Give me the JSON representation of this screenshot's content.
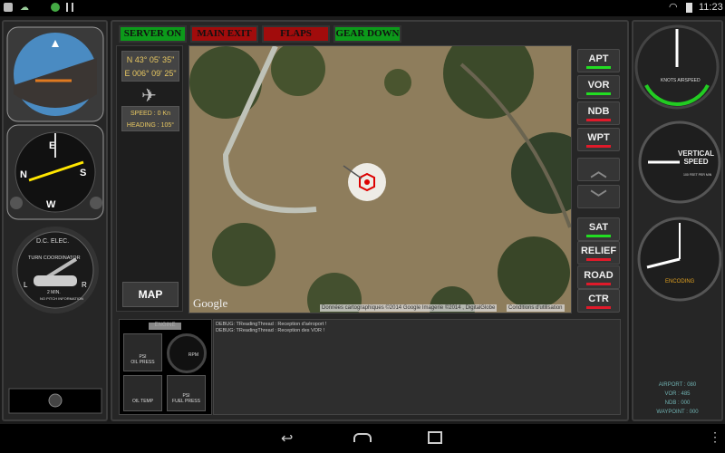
{
  "status_bar": {
    "time": "11:23",
    "icons": [
      "notification-icon",
      "android-icon",
      "badge-icon",
      "barcode-icon",
      "wifi-icon",
      "battery-icon"
    ]
  },
  "top_buttons": [
    {
      "label": "SERVER ON",
      "color": "#0c9a1a"
    },
    {
      "label": "MAIN EXIT",
      "color": "#a10c0c"
    },
    {
      "label": "FLAPS",
      "color": "#a10c0c"
    },
    {
      "label": "GEAR DOWN",
      "color": "#0c9a1a"
    }
  ],
  "info": {
    "lat": "N 43° 05' 35\"",
    "lon": "E 006° 09' 25\"",
    "speed": "SPEED :  0 Kn",
    "heading": "HEADING : 105°",
    "map_button": "MAP"
  },
  "map": {
    "logo": "Google",
    "attribution": "Données cartographiques ©2014 Google Imagerie ©2014 , DigitalGlobe",
    "terms": "Conditions d'utilisation"
  },
  "right_buttons": [
    {
      "label": "APT",
      "state": "on"
    },
    {
      "label": "VOR",
      "state": "on"
    },
    {
      "label": "NDB",
      "state": "off"
    },
    {
      "label": "WPT",
      "state": "off"
    }
  ],
  "layer_buttons": [
    {
      "label": "SAT",
      "state": "on"
    },
    {
      "label": "RELIEF",
      "state": "off"
    },
    {
      "label": "ROAD",
      "state": "off"
    },
    {
      "label": "CTR",
      "state": "off"
    }
  ],
  "colors": {
    "on": "#22dd22",
    "off": "#e01a2a"
  },
  "engine": {
    "title": "ENGINE",
    "oil_press": "OIL PRESS",
    "rpm": "RPM",
    "oil_temp": "OIL TEMP",
    "fuel_press": "FUEL PRESS",
    "psi": "PSI"
  },
  "debug": [
    "DEBUG: TReadingThread : Reception d'aéroport !",
    "DEBUG: TReadingThread : Reception des VOR !"
  ],
  "instruments": {
    "turn_coord_top": "D.C. ELEC.",
    "turn_coord": "TURN COORDINATOR",
    "turn_coord_min": "2 MIN.",
    "turn_coord_note": "NO PITCH INFORMATION",
    "airspeed": "KNOTS AIRSPEED",
    "vsi": "VERTICAL SPEED",
    "vsi_units": "100 FEET PER MIN",
    "altimeter": "ENCODING"
  },
  "stats": {
    "airport": "AIRPORT : 080",
    "vor": "VOR : 485",
    "ndb": "NDB : 000",
    "waypoint": "WAYPOINT : 000"
  }
}
